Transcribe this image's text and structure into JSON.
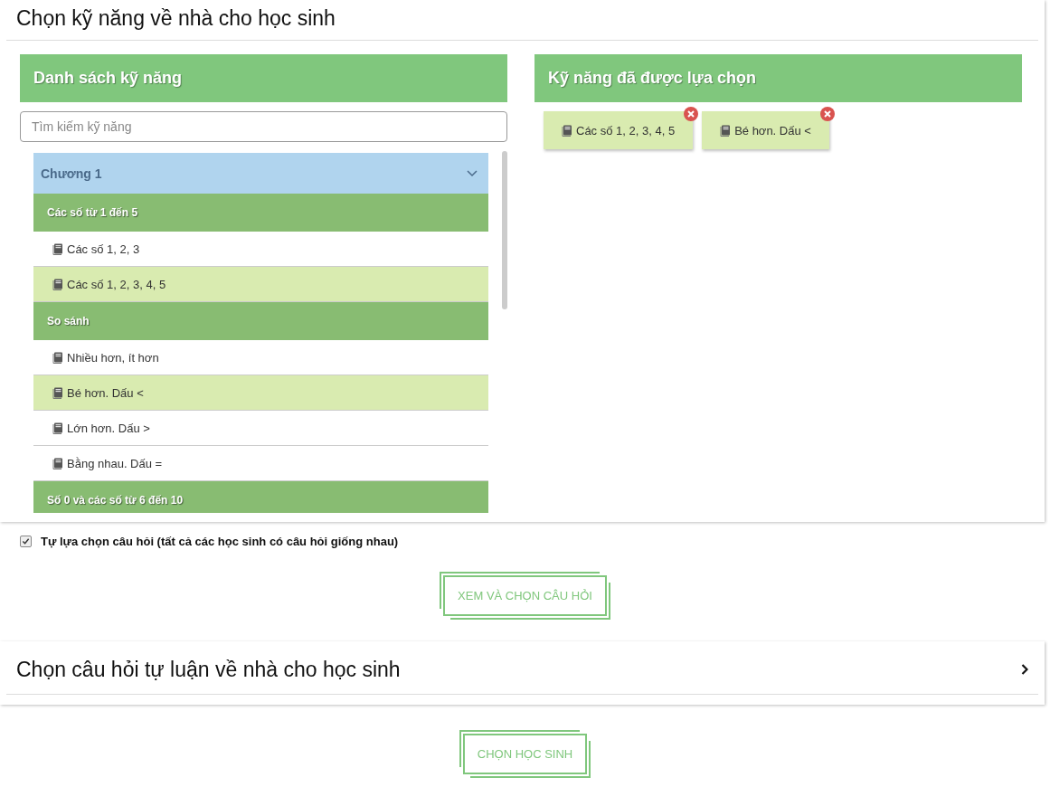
{
  "skills_section": {
    "title": "Chọn kỹ năng về nhà cho học sinh",
    "skill_list": {
      "header": "Danh sách kỹ năng",
      "search": {
        "placeholder": "Tìm kiếm kỹ năng"
      },
      "chapters": [
        {
          "label": "Chương 1",
          "expanded": true,
          "children": [
            {
              "label": "Các số từ 1 đến 5",
              "children": [
                {
                  "label": "Các số 1, 2, 3",
                  "selected": false
                },
                {
                  "label": "Các số 1, 2, 3, 4, 5",
                  "selected": true
                }
              ]
            },
            {
              "label": "So sánh",
              "children": [
                {
                  "label": "Nhiều hơn, ít hơn",
                  "selected": false
                },
                {
                  "label": "Bé hơn. Dấu <",
                  "selected": true
                },
                {
                  "label": "Lớn hơn. Dấu >",
                  "selected": false
                },
                {
                  "label": "Bằng nhau. Dấu =",
                  "selected": false
                }
              ]
            },
            {
              "label": "Số 0 và các số từ 6 đến 10"
            }
          ]
        }
      ]
    },
    "selected_skills": {
      "header": "Kỹ năng đã được lựa chọn",
      "items": [
        "Các số 1, 2, 3, 4, 5",
        "Bé hơn. Dấu <"
      ]
    }
  },
  "same_questions": {
    "label": "Tự lựa chọn câu hỏi (tất cả các học sinh có câu hỏi giống nhau)",
    "checked": true
  },
  "view_questions_button": "XEM VÀ CHỌN CÂU HỎI",
  "essay_section": {
    "title": "Chọn câu hỏi tự luận về nhà cho học sinh",
    "expanded": false
  },
  "choose_students_button": "CHỌN HỌC SINH"
}
